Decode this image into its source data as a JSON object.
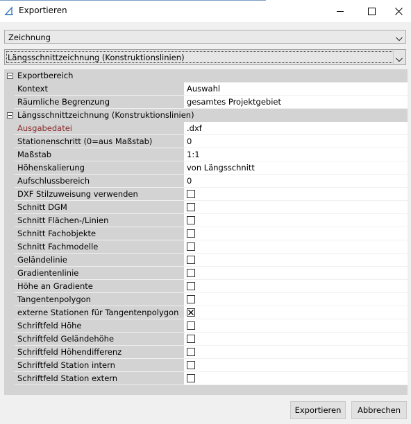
{
  "window": {
    "title": "Exportieren",
    "icons": [
      "app-triangle-icon",
      "minimize-icon",
      "maximize-icon",
      "close-icon"
    ]
  },
  "dropdowns": {
    "type": {
      "value": "Zeichnung"
    },
    "variant": {
      "value": "Längsschnittzeichnung (Konstruktionslinien)"
    }
  },
  "grid": {
    "categories": [
      {
        "label": "Exportbereich",
        "items": [
          {
            "name": "Kontext",
            "value": "Auswahl"
          },
          {
            "name": "Räumliche Begrenzung",
            "value": "gesamtes Projektgebiet"
          }
        ]
      },
      {
        "label": "Längsschnittzeichnung (Konstruktionslinien)",
        "items": [
          {
            "name": "Ausgabedatei",
            "value": ".dxf",
            "highlight": "#8b2a2a"
          },
          {
            "name": "Stationenschritt (0=aus Maßstab)",
            "value": "0"
          },
          {
            "name": "Maßstab",
            "value": "1:1"
          },
          {
            "name": "Höhenskalierung",
            "value": "von Längsschnitt"
          },
          {
            "name": "Aufschlussbereich",
            "value": "0"
          },
          {
            "name": "DXF Stilzuweisung verwenden",
            "checked": false
          },
          {
            "name": "Schnitt DGM",
            "checked": false
          },
          {
            "name": "Schnitt Flächen-/Linien",
            "checked": false
          },
          {
            "name": "Schnitt Fachobjekte",
            "checked": false
          },
          {
            "name": "Schnitt Fachmodelle",
            "checked": false
          },
          {
            "name": "Geländelinie",
            "checked": false
          },
          {
            "name": "Gradientenlinie",
            "checked": false
          },
          {
            "name": "Höhe an Gradiente",
            "checked": false
          },
          {
            "name": "Tangentenpolygon",
            "checked": false
          },
          {
            "name": "externe Stationen für Tangentenpolygon",
            "checked": true
          },
          {
            "name": "Schriftfeld Höhe",
            "checked": false
          },
          {
            "name": "Schriftfeld Geländehöhe",
            "checked": false
          },
          {
            "name": "Schriftfeld Höhendifferenz",
            "checked": false
          },
          {
            "name": "Schriftfeld Station intern",
            "checked": false
          },
          {
            "name": "Schriftfeld Station extern",
            "checked": false
          }
        ]
      }
    ]
  },
  "buttons": {
    "export": "Exportieren",
    "cancel": "Abbrechen"
  }
}
